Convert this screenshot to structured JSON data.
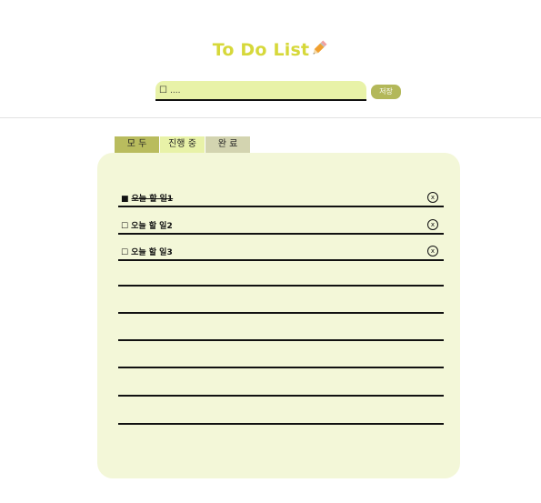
{
  "header": {
    "title": "To Do List",
    "title_icon": "pencil-icon"
  },
  "input": {
    "check_glyph": "☐",
    "value": "...."
  },
  "save_button": {
    "label": "저장"
  },
  "tabs": [
    {
      "label": "모 두"
    },
    {
      "label": "진행 중"
    },
    {
      "label": "완 료"
    }
  ],
  "todos": [
    {
      "box": "■",
      "text": "오늘 할 일1",
      "done": true,
      "delete_glyph": "x"
    },
    {
      "box": "☐",
      "text": "오늘 할 일2",
      "done": false,
      "delete_glyph": "x"
    },
    {
      "box": "☐",
      "text": "오늘 할 일3",
      "done": false,
      "delete_glyph": "x"
    }
  ],
  "colors": {
    "title": "#d6d83a",
    "input_bg": "#e8f2a8",
    "save_button": "#b3b85a",
    "tab_all": "#b9bc5e",
    "tab_progress": "#e8f2a8",
    "tab_done": "#d3d4b0",
    "panel_bg": "#f3f7d8"
  }
}
